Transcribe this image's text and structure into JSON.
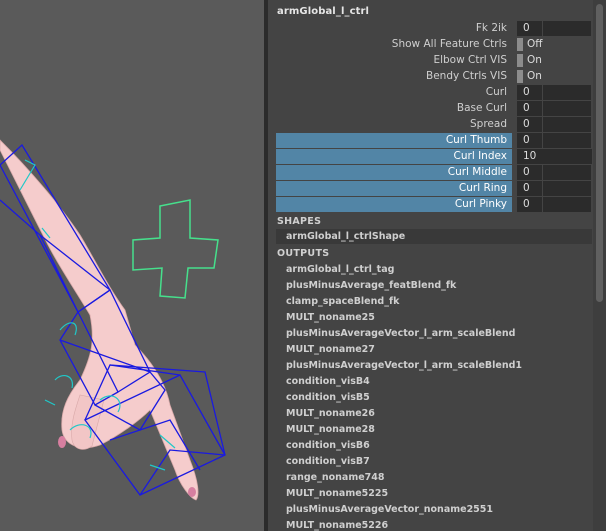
{
  "node_title": "armGlobal_l_ctrl",
  "toggle_attrs": [
    {
      "label": "Show All Feature Ctrls",
      "value": "Off"
    },
    {
      "label": "Elbow Ctrl VIS",
      "value": "On"
    },
    {
      "label": "Bendy Ctrls VIS",
      "value": "On"
    }
  ],
  "numeric_attrs": [
    {
      "label": "Fk 2ik",
      "value": "0"
    },
    {
      "label": "Curl",
      "value": "0"
    },
    {
      "label": "Base Curl",
      "value": "0"
    },
    {
      "label": "Spread",
      "value": "0"
    },
    {
      "label": "Curl Thumb",
      "value": "0"
    },
    {
      "label": "Curl Index",
      "value": "10"
    },
    {
      "label": "Curl Middle",
      "value": "0"
    },
    {
      "label": "Curl Ring",
      "value": "0"
    },
    {
      "label": "Curl Pinky",
      "value": "0"
    }
  ],
  "shapes": {
    "heading": "SHAPES",
    "items": [
      "armGlobal_l_ctrlShape"
    ]
  },
  "outputs": {
    "heading": "OUTPUTS",
    "items": [
      "armGlobal_l_ctrl_tag",
      "plusMinusAverage_featBlend_fk",
      "clamp_spaceBlend_fk",
      "MULT_noname25",
      "plusMinusAverageVector_l_arm_scaleBlend",
      "MULT_noname27",
      "plusMinusAverageVector_l_arm_scaleBlend1",
      "condition_visB4",
      "condition_visB5",
      "MULT_noname26",
      "MULT_noname28",
      "condition_visB6",
      "condition_visB7",
      "range_noname748",
      "MULT_noname5225",
      "plusMinusAverageVector_noname2551",
      "MULT_noname5226"
    ]
  },
  "colors": {
    "highlight": "#5285a6",
    "panel_bg": "#444444",
    "viewport_bg": "#5a5a5a",
    "wireframe": "#1a1ae0",
    "control_curve": "#46e08c",
    "skin": "#f6cdcd",
    "joint_curve": "#20c8c8"
  },
  "icons": {
    "viewport": "3d-hand-model",
    "control": "plus-control-curve"
  }
}
